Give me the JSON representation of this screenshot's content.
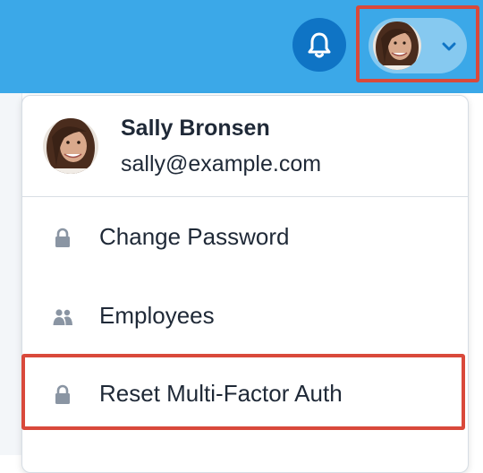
{
  "header": {
    "notifications_icon": "bell-icon",
    "user_menu_icon": "chevron-down-icon"
  },
  "user_menu": {
    "name": "Sally Bronsen",
    "email": "sally@example.com",
    "items": [
      {
        "label": "Change Password",
        "icon": "lock-icon"
      },
      {
        "label": "Employees",
        "icon": "users-icon"
      },
      {
        "label": "Reset Multi-Factor Auth",
        "icon": "lock-icon"
      }
    ]
  },
  "colors": {
    "topbar": "#3ba8e8",
    "bell_button": "#0f74c5",
    "user_pill": "#86c9f0",
    "highlight": "#d9493b",
    "icon_gray": "#8a95a3",
    "text": "#1f2937"
  }
}
